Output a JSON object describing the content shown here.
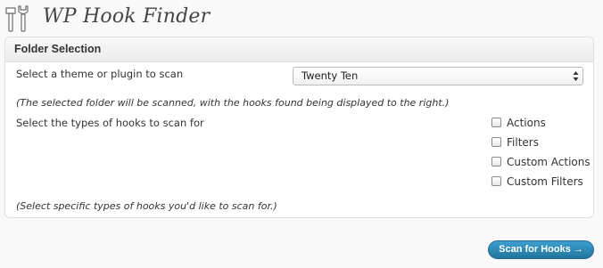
{
  "header": {
    "icon": "tools-icon",
    "title": "WP Hook Finder"
  },
  "folder_selection": {
    "title": "Folder Selection",
    "select_label": "Select a theme or plugin to scan",
    "select_value": "Twenty Ten",
    "select_note": "(The selected folder will be scanned, with the hooks found being displayed to the right.)",
    "types_label": "Select the types of hooks to scan for",
    "hook_types": [
      {
        "label": "Actions",
        "checked": false
      },
      {
        "label": "Filters",
        "checked": false
      },
      {
        "label": "Custom Actions",
        "checked": false
      },
      {
        "label": "Custom Filters",
        "checked": false
      }
    ],
    "types_note": "(Select specific types of hooks you'd like to scan for.)"
  },
  "scan_button": {
    "label": "Scan for Hooks →"
  },
  "colors": {
    "button": "#21759b",
    "background": "#f9f9f9",
    "panel_border": "#dfdfdf"
  }
}
